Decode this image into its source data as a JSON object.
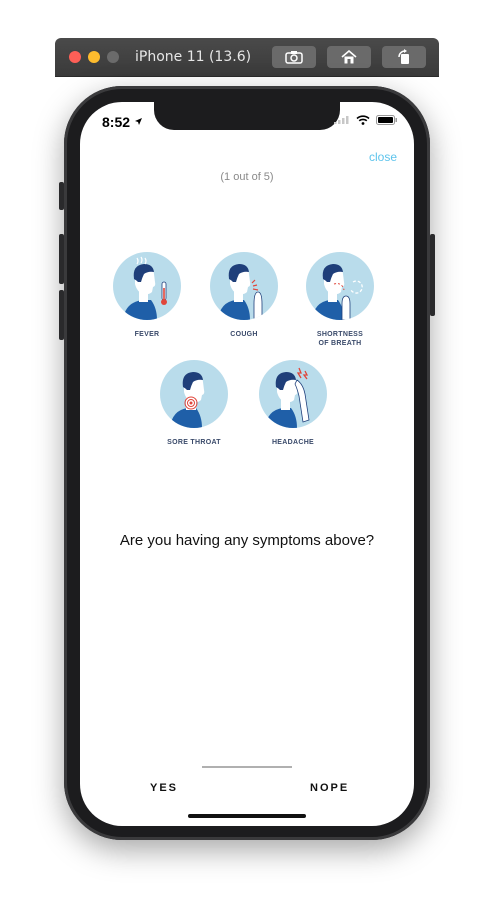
{
  "simulator": {
    "title": "iPhone 11 (13.6)",
    "buttons": [
      "screenshot-icon",
      "home-icon",
      "rotate-icon"
    ]
  },
  "status_bar": {
    "time": "8:52",
    "icons": [
      "location-arrow-icon",
      "signal-icon",
      "wifi-icon",
      "battery-icon"
    ]
  },
  "header": {
    "close_label": "close",
    "progress": "(1 out of 5)"
  },
  "symptoms": [
    {
      "label": "FEVER",
      "icon": "fever-icon"
    },
    {
      "label": "COUGH",
      "icon": "cough-icon"
    },
    {
      "label": "SHORTNESS\nOF BREATH",
      "icon": "shortness-of-breath-icon"
    },
    {
      "label": "SORE THROAT",
      "icon": "sore-throat-icon"
    },
    {
      "label": "HEADACHE",
      "icon": "headache-icon"
    }
  ],
  "question": "Are you having any symptoms above?",
  "answers": {
    "yes": "YES",
    "nope": "NOPE"
  },
  "colors": {
    "accent": "#5ec4ec",
    "icon_circle": "#b9dceb",
    "figure_dark": "#1f3f7a",
    "figure_blue": "#1f5fa8",
    "alert": "#e0453a"
  }
}
